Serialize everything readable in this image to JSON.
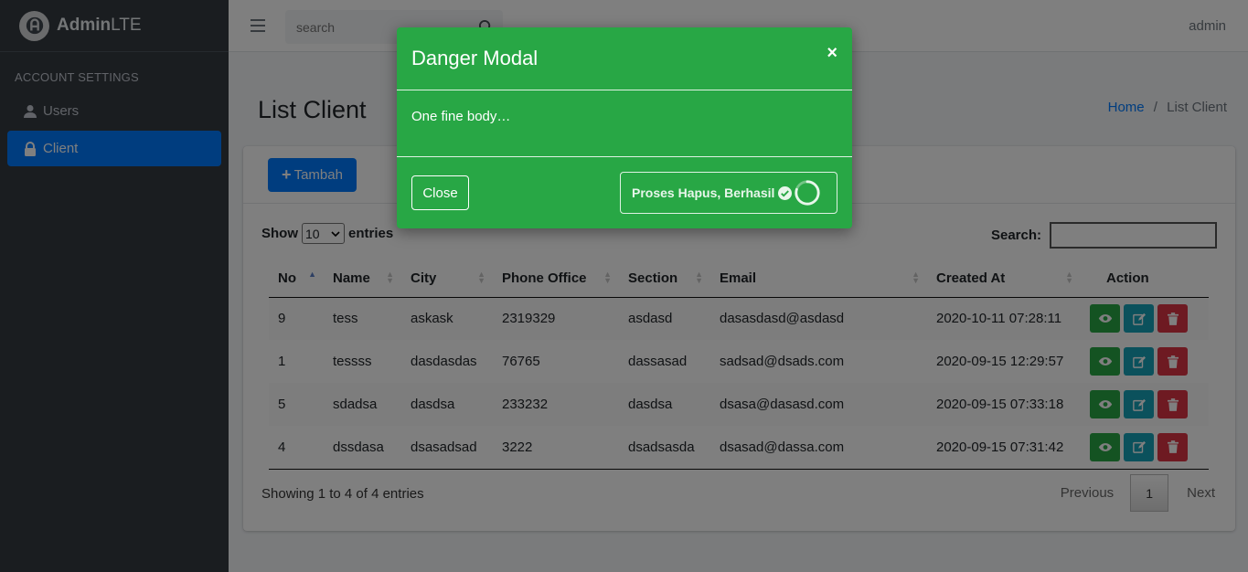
{
  "brand": {
    "name_bold": "Admin",
    "name_light": "LTE"
  },
  "sidebar": {
    "header": "ACCOUNT SETTINGS",
    "items": [
      {
        "label": "Users",
        "icon": "user-icon",
        "active": false
      },
      {
        "label": "Client",
        "icon": "lock-icon",
        "active": true
      }
    ]
  },
  "header": {
    "search_placeholder": "search",
    "user": "admin"
  },
  "page": {
    "title": "List Client",
    "breadcrumb": {
      "home": "Home",
      "separator": "/",
      "current": "List Client"
    }
  },
  "card": {
    "add_button": "Tambah",
    "length": {
      "prefix": "Show",
      "value": "10",
      "suffix": "entries"
    },
    "search_label": "Search:",
    "columns": [
      "No",
      "Name",
      "City",
      "Phone Office",
      "Section",
      "Email",
      "Created At",
      "Action"
    ],
    "rows": [
      {
        "no": "9",
        "name": "tess",
        "city": "askask",
        "phone": "2319329",
        "section": "asdasd",
        "email": "dasasdasd@asdasd",
        "created": "2020-10-11 07:28:11"
      },
      {
        "no": "1",
        "name": "tessss",
        "city": "dasdasdas",
        "phone": "76765",
        "section": "dassasad",
        "email": "sadsad@dsads.com",
        "created": "2020-09-15 12:29:57"
      },
      {
        "no": "5",
        "name": "sdadsa",
        "city": "dasdsa",
        "phone": "233232",
        "section": "dasdsa",
        "email": "dsasa@dasasd.com",
        "created": "2020-09-15 07:33:18"
      },
      {
        "no": "4",
        "name": "dssdasa",
        "city": "dsasadsad",
        "phone": "3222",
        "section": "dsadsasda",
        "email": "dsasad@dassa.com",
        "created": "2020-09-15 07:31:42"
      }
    ],
    "info": "Showing 1 to 4 of 4 entries",
    "pager": {
      "prev": "Previous",
      "page": "1",
      "next": "Next"
    }
  },
  "modal": {
    "title": "Danger Modal",
    "close_symbol": "×",
    "body": "One fine body…",
    "close_button": "Close",
    "action_button": "Proses Hapus, Berhasil"
  },
  "colors": {
    "sidebar": "#343a40",
    "primary": "#007bff",
    "modal": "#28a745",
    "info": "#17a2b8",
    "danger": "#dc3545"
  }
}
